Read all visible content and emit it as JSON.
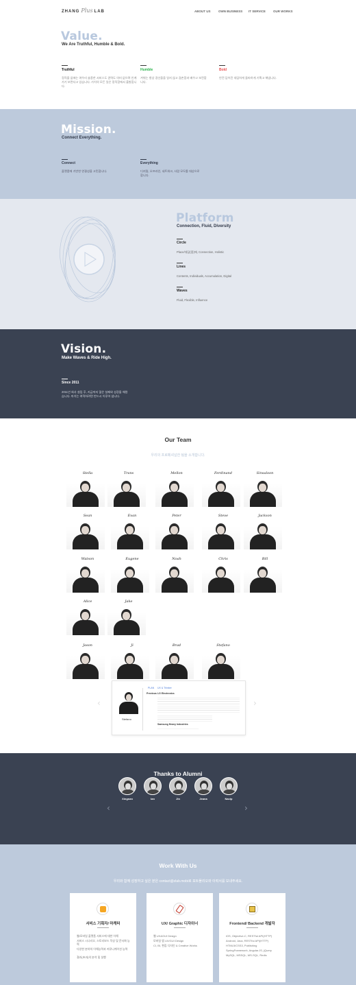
{
  "header": {
    "logo_a": "ZHANG",
    "logo_script": "Plus",
    "logo_b": "LAB",
    "nav": [
      "ABOUT US",
      "OWN BUSINESS",
      "IT SERVICE",
      "OUR WORKS"
    ]
  },
  "value": {
    "title": "Value.",
    "subtitle": "We Are Truthful, Humble & Bold.",
    "cols": [
      {
        "label": "Truthful",
        "text": "정직을 없애는 여우리 솔풍한 서비스도 권력도 의미 없으며 인계가기 보면다고 있습니다. 가치의 모든 일은 정직함에서 출발합니다.",
        "color": "#111111"
      },
      {
        "label": "Humble",
        "text": "겨위는 항상 경선을을 일지 않고 겸손함과 배우고 보전합니다.",
        "color": "#2bb24c"
      },
      {
        "label": "Bold",
        "text": "안전 담어진 대담하게 돌파하게 기획고 해냅니다.",
        "color": "#e94e4e"
      }
    ]
  },
  "mission": {
    "title": "Mission.",
    "subtitle": "Connect Everything.",
    "cols": [
      {
        "label": "Connect",
        "text": "플랫폼에 기반한 연결성을 고민합니다."
      },
      {
        "label": "Everything",
        "text": "디지털, 오프라인, 네트워크, 사람 모두를 대상으로합니다."
      }
    ]
  },
  "platform": {
    "title": "Platform",
    "subtitle": "Connection, Fluid, Diversity",
    "items": [
      {
        "label": "Circle",
        "text": "Place/대담(중)에, Connection, Holistic"
      },
      {
        "label": "Lines",
        "text": "Contents, Individuals, Accumulation, Digital"
      },
      {
        "label": "Waves",
        "text": "Fluid, Flexible, Influence"
      }
    ]
  },
  "vision": {
    "title": "Vision.",
    "subtitle": "Make Waves & Ride High.",
    "since": "Since 2011",
    "text": "2011년 회사 설립 후, 지금까지 많은 실패와 성장을 해왔습니다. 마치는 여적하려면 반드시 이루어 냅니다."
  },
  "team": {
    "title": "Our Team",
    "subtitle": "우리의 프로페셔널한 팀을 소개합니다.",
    "members": [
      "Stella",
      "Trans",
      "Mellon",
      "Ferdinand",
      "Sinsaloon",
      "Sean",
      "Evan",
      "Peter",
      "Steve",
      "Jackson",
      "Watson",
      "Eugene",
      "Noah",
      "Chris",
      "Bill",
      "Alice",
      "Jake",
      "Jason",
      "Ji",
      "Brad",
      "Stefano"
    ],
    "profile": {
      "name": "Stefano",
      "role": "UX & Thinker",
      "head": "Previous",
      "company1": "LG Electronics",
      "company2": "Samsung Heavy Industries",
      "dept": "PLAN"
    }
  },
  "alumni": {
    "title": "Thanks to Alumni",
    "names": [
      "Xingnan",
      "Ian",
      "Jin",
      "Jeana",
      "Nacip"
    ]
  },
  "work": {
    "title": "Work With Us",
    "subtitle": "우리와 함께 성장하고 싶은 분은 contact@zlab.mobi로 포트폴리오와 이력서를 보내주세요.",
    "cards": [
      {
        "title": "서비스 기획자/ 마케터",
        "items": [
          "웹/모바일 플랫폼 서비스에 대한 이해",
          "서비스 시나리오, 스토리보드 작성 및 문서화 능력",
          "다양한 분야의 이해능력과 커뮤니케이션 능력",
          "결과(초과)의 분석 및 실행"
        ]
      },
      {
        "title": "UX/ Graphic 디자이너",
        "items": [
          "웹 UX&GUI Design",
          "모바일 앱 UX/GUI Design",
          "CI, BI, 편집 디자인 & Creative Works"
        ]
      },
      {
        "title": "Frontend/ Backend 개발자",
        "items": [
          "iOS, Objective-C, RESTful API(HTTP)",
          "Android, Java, RESTful API(HTTP)",
          "HTML5/CSS3, Publishing",
          "SpringFramework, Angular.JS, jQuery",
          "MySQL, MSSQL, MS-SQL, Redis"
        ]
      }
    ]
  },
  "colors": {
    "value_title": "#b8c8de",
    "band": "#bdcadc",
    "platform_bg": "#e4e8ef",
    "navy": "#3a4252"
  }
}
